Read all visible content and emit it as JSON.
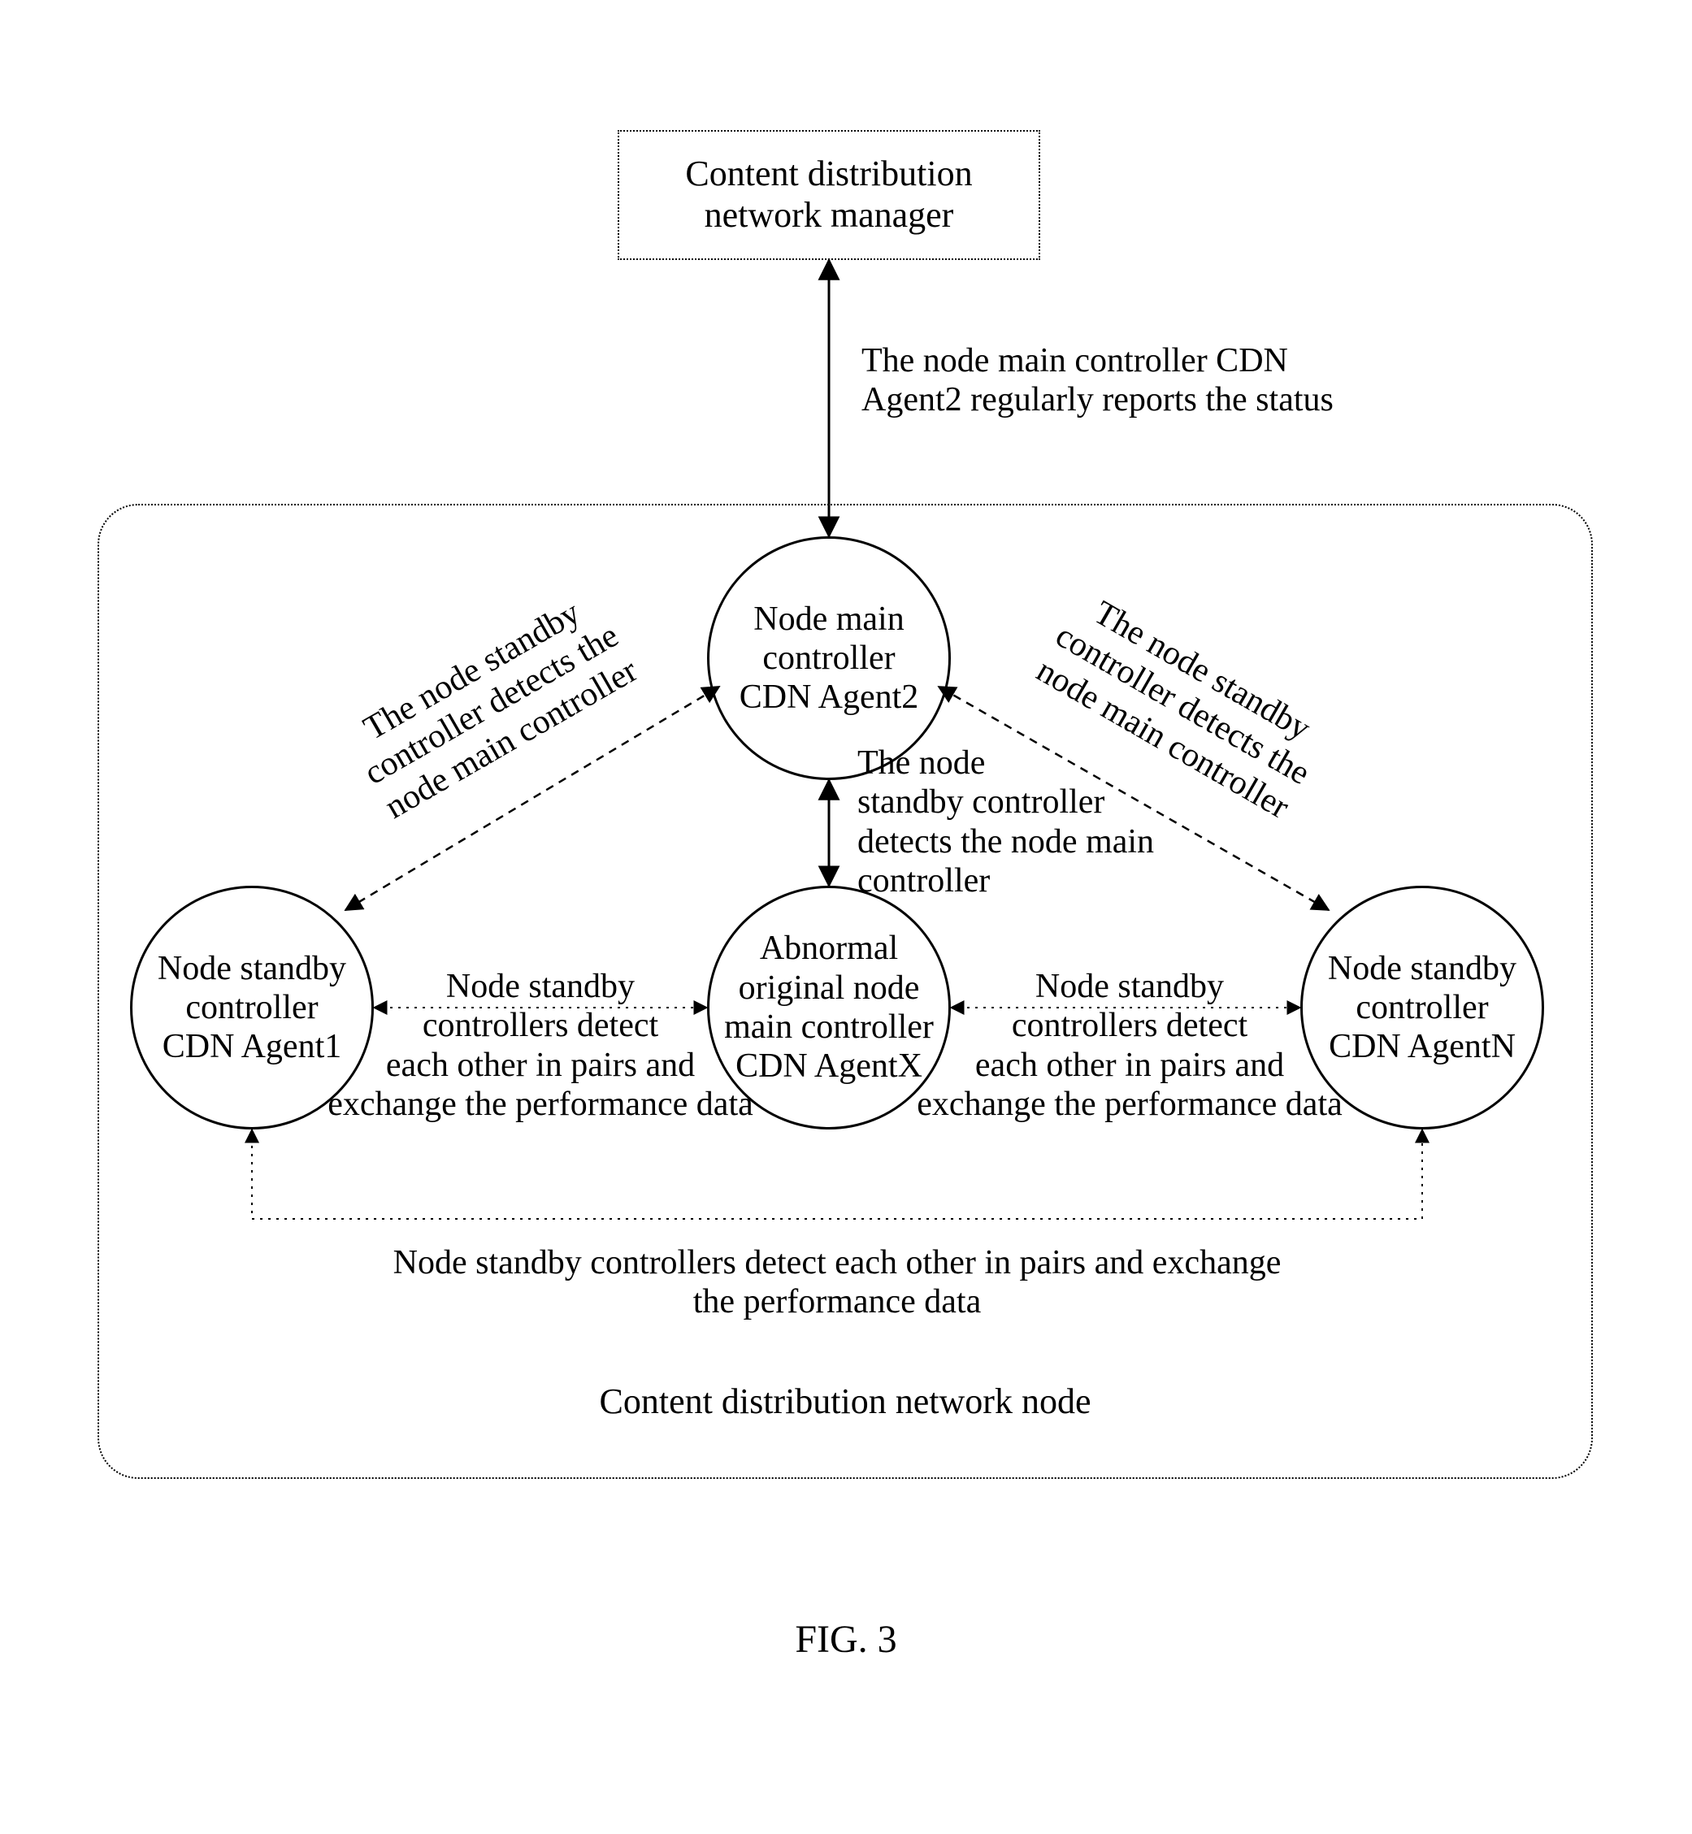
{
  "manager": {
    "label": "Content distribution\nnetwork manager"
  },
  "nodeBoxLabel": "Content distribution network node",
  "nodes": {
    "main": {
      "label": "Node main\ncontroller\nCDN Agent2"
    },
    "standby1": {
      "label": "Node standby\ncontroller\nCDN Agent1"
    },
    "abnormal": {
      "label": "Abnormal\noriginal node\nmain controller\nCDN AgentX"
    },
    "standbyN": {
      "label": "Node standby\ncontroller\nCDN AgentN"
    }
  },
  "edges": {
    "report": "The node main controller CDN\nAgent2 regularly reports the status",
    "detect_left": "The node standby\ncontroller detects the\nnode main controller",
    "detect_right": "The node standby\ncontroller detects the\nnode main controller",
    "detect_center": "The node\nstandby controller\ndetects the node main\ncontroller",
    "pair_left": "Node standby\ncontrollers detect\neach other in pairs and\nexchange the performance data",
    "pair_right": "Node standby\ncontrollers detect\neach other in pairs and\nexchange the performance data",
    "pair_bottom": "Node standby controllers detect each other in pairs and exchange\nthe performance data"
  },
  "figure": "FIG. 3"
}
